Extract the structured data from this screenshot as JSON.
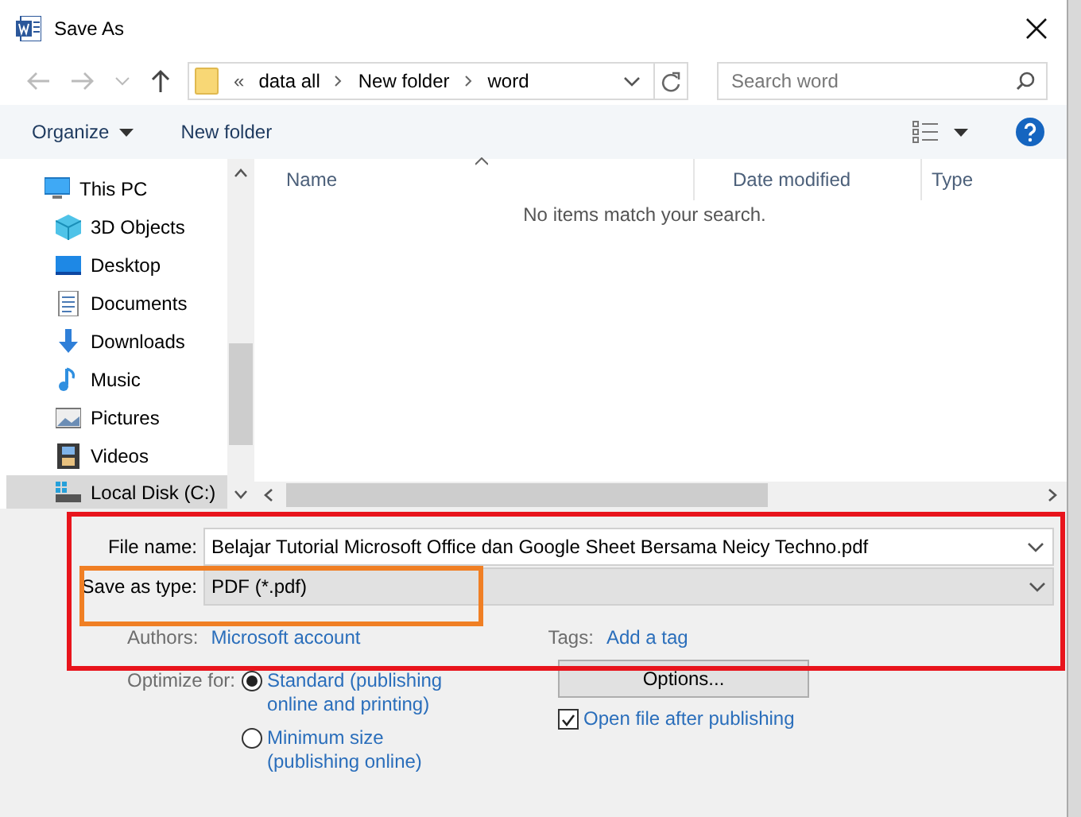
{
  "window": {
    "title": "Save As"
  },
  "address_bar": {
    "overflow": "«",
    "path": [
      {
        "label": "data all"
      },
      {
        "label": "New folder"
      },
      {
        "label": "word"
      }
    ]
  },
  "search": {
    "placeholder": "Search word"
  },
  "toolbar": [
    {
      "label": "Organize",
      "kind": "menu"
    },
    {
      "label": "New folder",
      "kind": "button"
    }
  ],
  "sidebar": {
    "items": [
      {
        "label": "This PC",
        "selected": false,
        "children": [
          {
            "label": "3D Objects",
            "selected": false
          },
          {
            "label": "Desktop",
            "selected": false
          },
          {
            "label": "Documents",
            "selected": false
          },
          {
            "label": "Downloads",
            "selected": false
          },
          {
            "label": "Music",
            "selected": false
          },
          {
            "label": "Pictures",
            "selected": false
          },
          {
            "label": "Videos",
            "selected": false
          },
          {
            "label": "Local Disk (C:)",
            "selected": true
          }
        ]
      }
    ]
  },
  "file_list": {
    "columns": [
      {
        "label": "Name"
      },
      {
        "label": "Date modified"
      },
      {
        "label": "Type"
      }
    ],
    "empty_message": "No items match your search."
  },
  "form": {
    "file_name": {
      "label": "File name:",
      "value": "Belajar Tutorial Microsoft Office dan Google Sheet Bersama Neicy Techno.pdf"
    },
    "save_as_type": {
      "label": "Save as type:",
      "value": "PDF (*.pdf)"
    },
    "authors": {
      "label": "Authors:",
      "value": "Microsoft account"
    },
    "tags": {
      "label": "Tags:",
      "value": "Add a tag"
    },
    "optimize": {
      "label": "Optimize for:",
      "options": [
        {
          "label": "Standard (publishing\nonline and printing)",
          "selected": true
        },
        {
          "label": "Minimum size\n(publishing online)",
          "selected": false
        }
      ]
    },
    "options_button": "Options...",
    "open_after": {
      "label": "Open file after publishing",
      "checked": true
    }
  },
  "highlights": [
    {
      "color": "#e8141c"
    },
    {
      "color": "#f07f24"
    }
  ]
}
